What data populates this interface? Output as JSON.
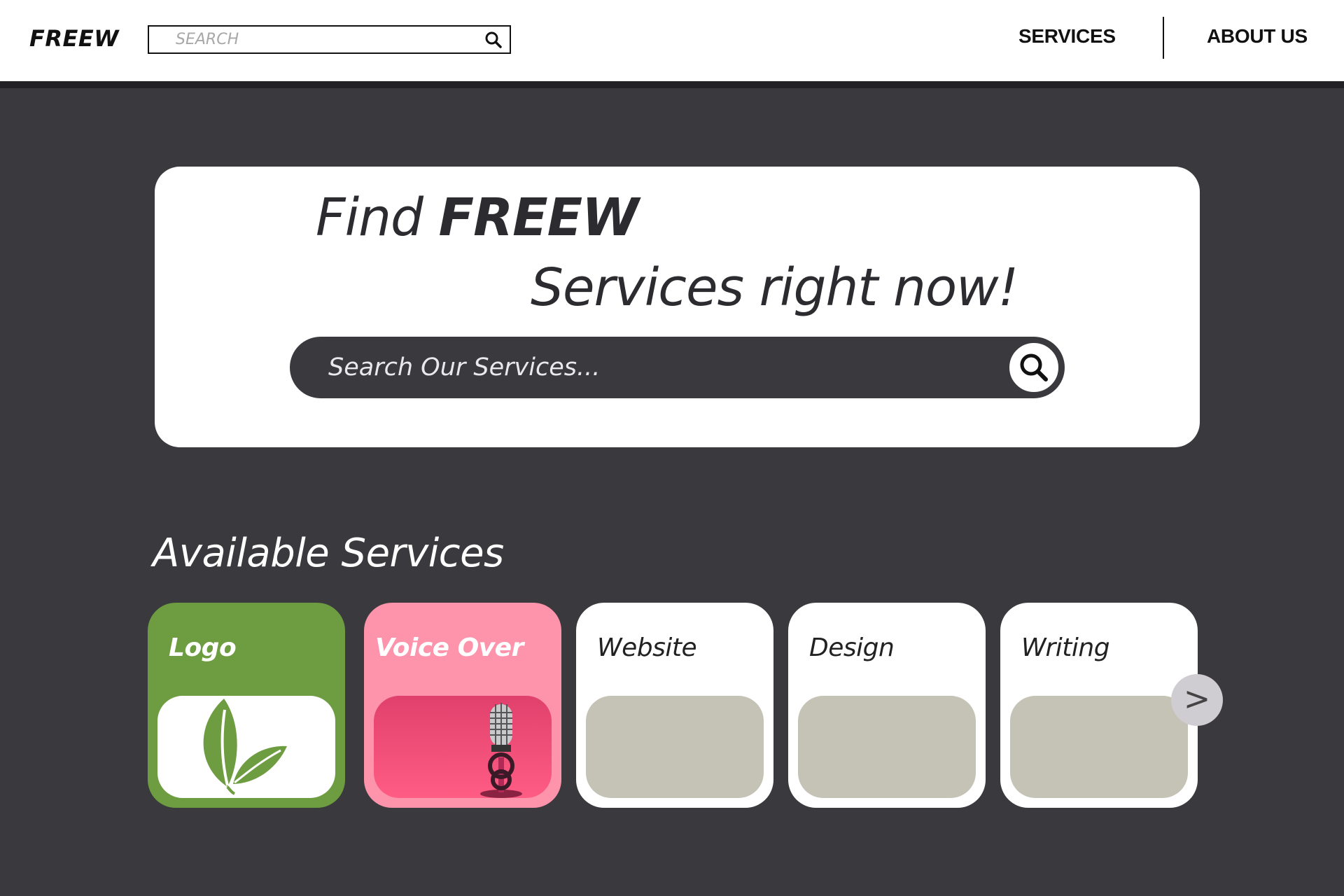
{
  "header": {
    "logo": "FREEW",
    "search_placeholder": "SEARCH",
    "nav": {
      "services": "SERVICES",
      "about": "ABOUT US"
    }
  },
  "hero": {
    "line1_prefix": "Find ",
    "line1_brand": "FREEW",
    "line2": "Services right now!",
    "search_placeholder": "Search Our Services..."
  },
  "services": {
    "title": "Available Services",
    "items": [
      {
        "label": "Logo",
        "color": "#6e9c40",
        "icon": "leaf-icon"
      },
      {
        "label": "Voice Over",
        "color": "#fd94ab",
        "icon": "microphone-icon"
      },
      {
        "label": "Website",
        "color": "#ffffff"
      },
      {
        "label": "Design",
        "color": "#ffffff"
      },
      {
        "label": "Writing",
        "color": "#ffffff"
      }
    ],
    "next_label": ">"
  },
  "colors": {
    "background": "#3a393e",
    "header": "#ffffff",
    "placeholder_tile": "#c5c2b6"
  }
}
